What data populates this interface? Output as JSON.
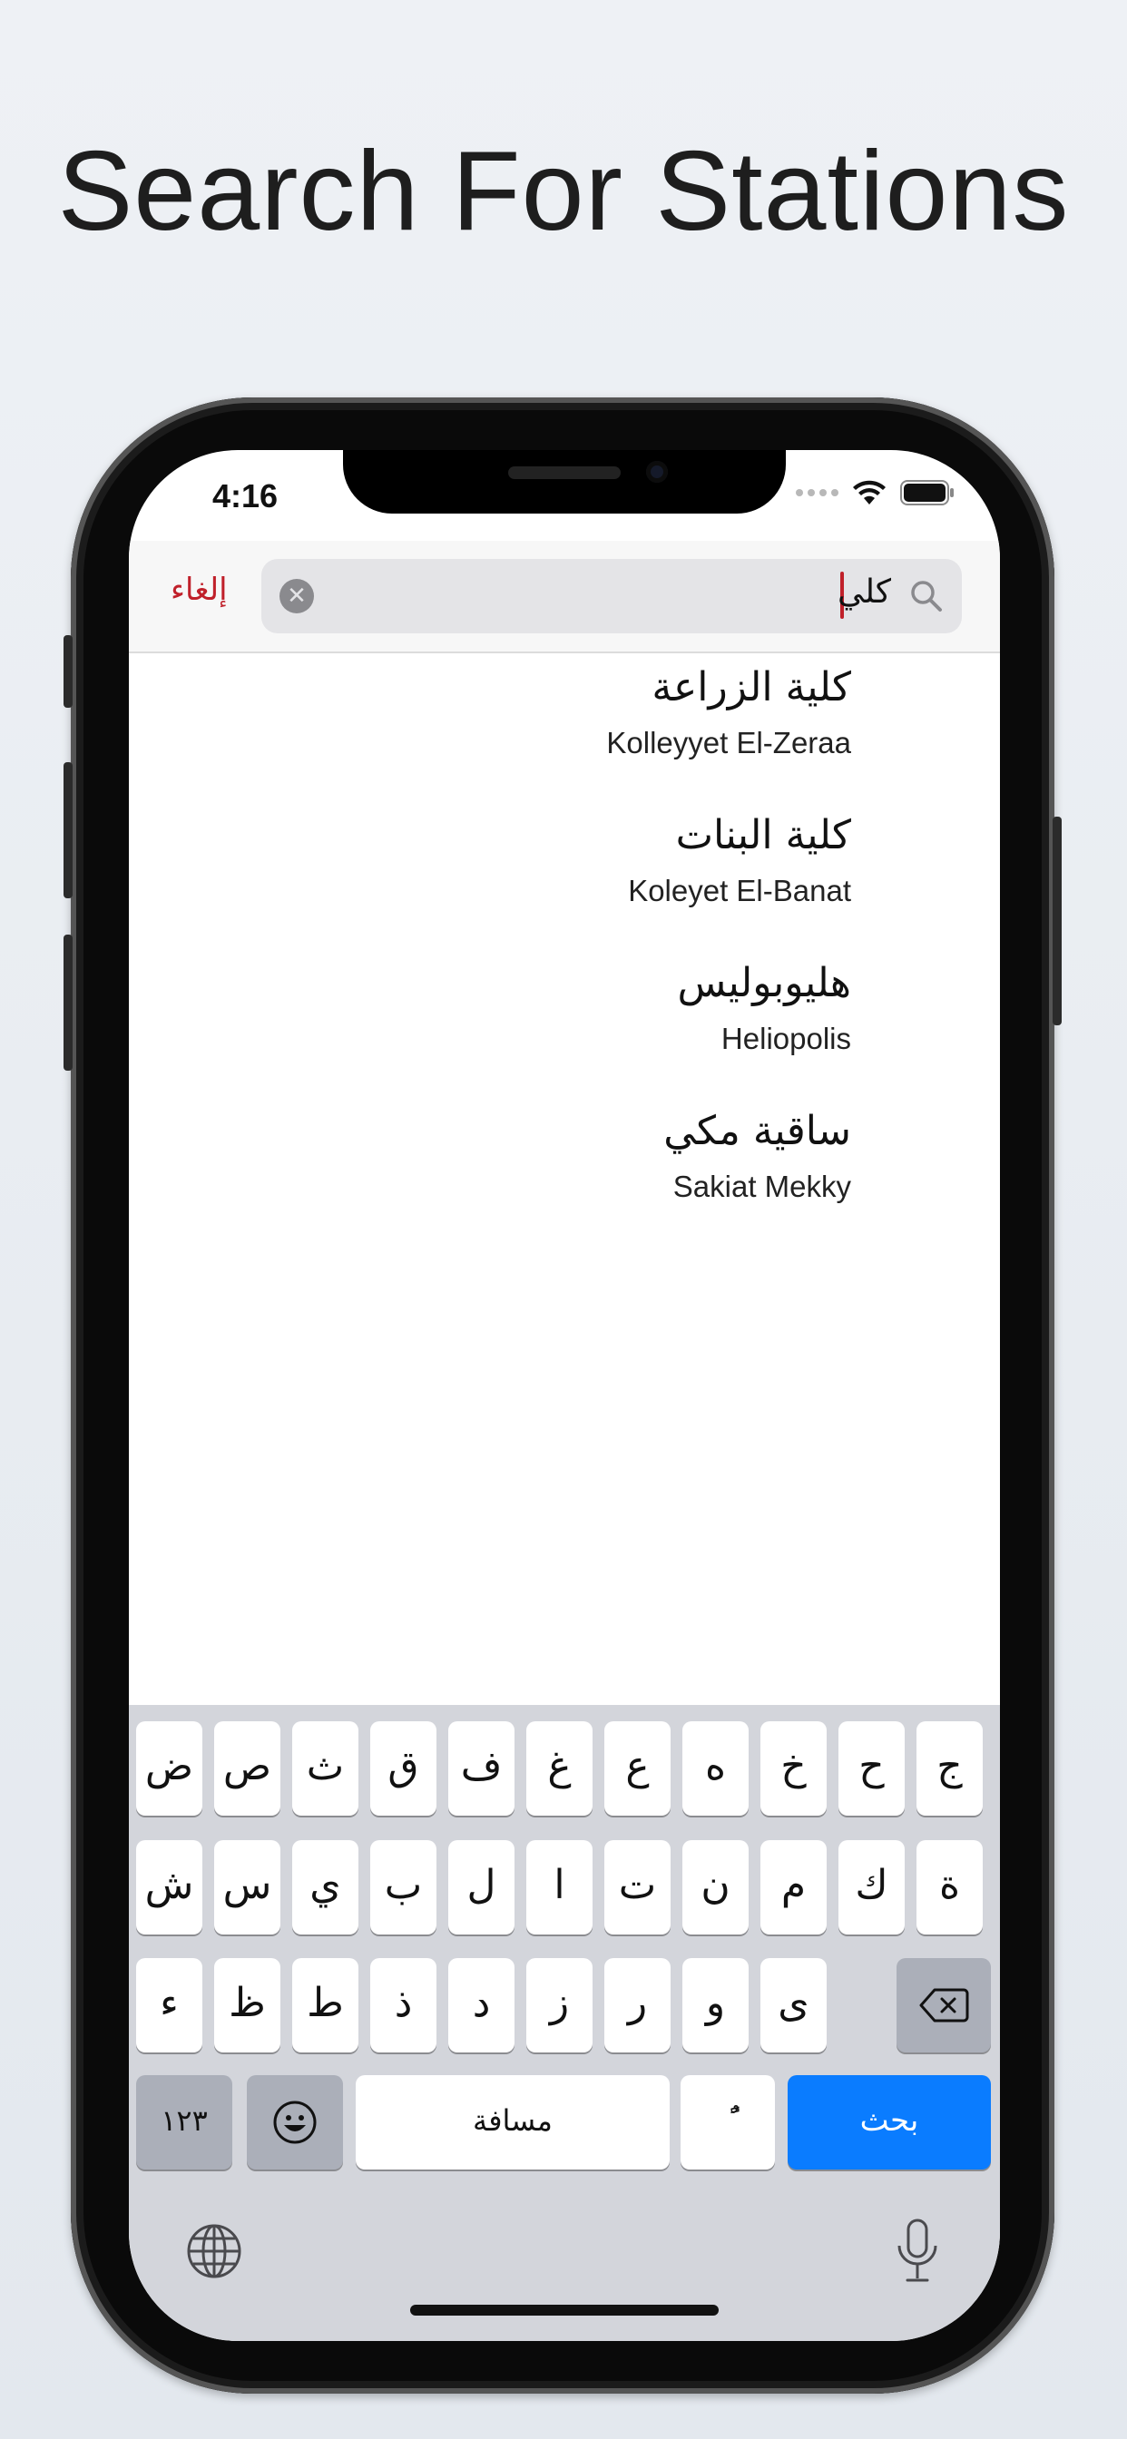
{
  "headline": "Search For Stations",
  "status": {
    "time": "4:16"
  },
  "search": {
    "cancel_label": "إلغاء",
    "query": "كلي"
  },
  "results": [
    {
      "arabic": "كلية الزراعة",
      "english": "Kolleyyet El-Zeraa"
    },
    {
      "arabic": "كلية البنات",
      "english": "Koleyet El-Banat"
    },
    {
      "arabic": "هليوبوليس",
      "english": "Heliopolis"
    },
    {
      "arabic": "ساقية مكي",
      "english": "Sakiat Mekky"
    }
  ],
  "keyboard": {
    "row1": [
      "ض",
      "ص",
      "ث",
      "ق",
      "ف",
      "غ",
      "ع",
      "ه",
      "خ",
      "ح",
      "ج"
    ],
    "row2": [
      "ش",
      "س",
      "ي",
      "ب",
      "ل",
      "ا",
      "ت",
      "ن",
      "م",
      "ك",
      "ة"
    ],
    "row3": [
      "ء",
      "ظ",
      "ط",
      "ذ",
      "د",
      "ز",
      "ر",
      "و",
      "ى"
    ],
    "numbers_label": "١٢٣",
    "space_label": "مسافة",
    "tanween_label": "ًٌ",
    "search_label": "بحث"
  },
  "icons": {
    "clear": "clear-icon",
    "search": "magnifier-icon",
    "backspace": "backspace-icon",
    "emoji": "emoji-icon",
    "globe": "globe-icon",
    "mic": "microphone-icon",
    "wifi": "wifi-icon",
    "battery": "battery-icon"
  },
  "colors": {
    "accent": "#c0202a",
    "key_blue": "#0a7cff"
  }
}
